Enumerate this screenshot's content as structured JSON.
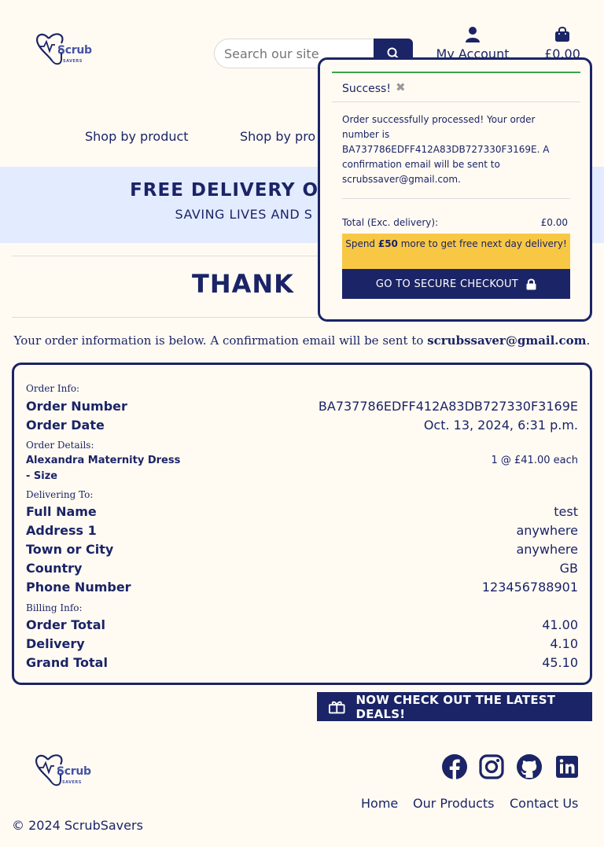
{
  "header": {
    "logo_text": "Scrub",
    "logo_subtext": "SAVERS",
    "search_placeholder": "Search our site",
    "account_label": "My Account",
    "cart_total": "£0.00",
    "nav": [
      "Shop by product",
      "Shop by pro"
    ]
  },
  "banner": {
    "title": "FREE DELIVERY ON O",
    "subtitle": "SAVING LIVES AND S"
  },
  "page": {
    "heading": "THANK",
    "info_prefix": "Your order information is below. A confirmation email will be sent to ",
    "info_email": "scrubssaver@gmail.com",
    "info_suffix": "."
  },
  "order": {
    "order_info_label": "Order Info:",
    "order_number_label": "Order Number",
    "order_number": "BA737786EDFF412A83DB727330F3169E",
    "order_date_label": "Order Date",
    "order_date": "Oct. 13, 2024, 6:31 p.m.",
    "order_details_label": "Order Details:",
    "item_name": "Alexandra Maternity Dress - Size",
    "item_qty": "1 @ £41.00 each",
    "delivering_label": "Delivering To:",
    "full_name_label": "Full Name",
    "full_name": "test",
    "address1_label": "Address 1",
    "address1": "anywhere",
    "town_label": "Town or City",
    "town": "anywhere",
    "country_label": "Country",
    "country": "GB",
    "phone_label": "Phone Number",
    "phone": "123456788901",
    "billing_label": "Billing Info:",
    "order_total_label": "Order Total",
    "order_total": "41.00",
    "delivery_label": "Delivery",
    "delivery": "4.10",
    "grand_total_label": "Grand Total",
    "grand_total": "45.10"
  },
  "deals_button": "NOW CHECK OUT THE LATEST DEALS!",
  "footer": {
    "links": [
      "Home",
      "Our Products",
      "Contact Us"
    ],
    "copyright": "© 2024 ScrubSavers"
  },
  "popup": {
    "title": "Success!",
    "close_icon": "✖",
    "message": "Order successfully processed! Your order number is BA737786EDFF412A83DB727330F3169E. A confirmation email will be sent to scrubssaver@gmail.com.",
    "total_label": "Total (Exc. delivery):",
    "total_value": "£0.00",
    "spend_prefix": "Spend ",
    "spend_amount": "£50",
    "spend_suffix": " more to get free next day delivery!",
    "checkout_label": "GO TO SECURE CHECKOUT"
  },
  "colors": {
    "navy": "#1b2466",
    "banner_bg": "#e3ebff",
    "success_green": "#3ca246",
    "spend_yellow": "#f8c845",
    "page_bg": "#fffbf3"
  },
  "icons": [
    "stethoscope-logo-icon",
    "search-icon",
    "user-icon",
    "shopping-bag-icon",
    "close-icon",
    "lock-icon",
    "gift-icon",
    "facebook-icon",
    "instagram-icon",
    "github-icon",
    "linkedin-icon"
  ]
}
